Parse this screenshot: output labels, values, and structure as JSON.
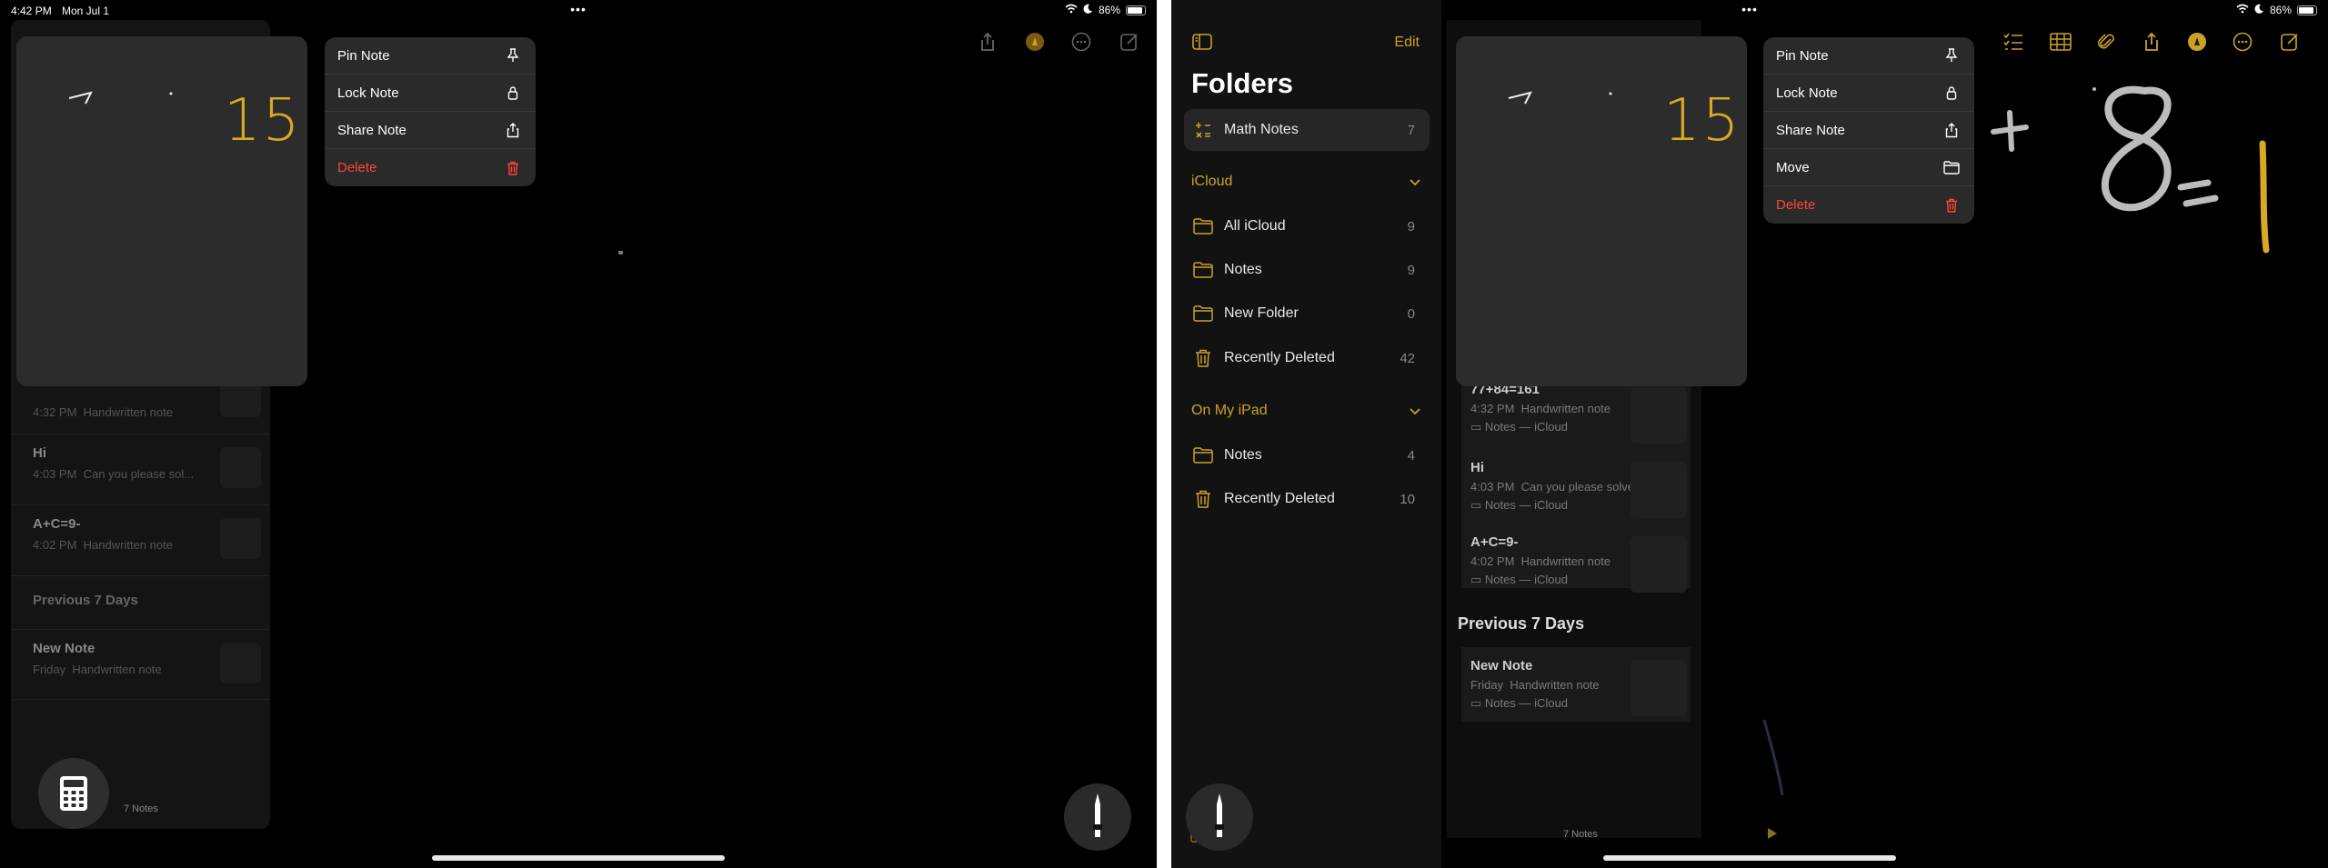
{
  "status": {
    "time": "4:42 PM",
    "date": "Mon Jul 1",
    "battery": "86%"
  },
  "left": {
    "preview_number": "15",
    "menu": [
      {
        "label": "Pin Note",
        "icon": "pin-icon",
        "danger": false
      },
      {
        "label": "Lock Note",
        "icon": "lock-icon",
        "danger": false
      },
      {
        "label": "Share Note",
        "icon": "share-icon",
        "danger": false
      },
      {
        "label": "Delete",
        "icon": "trash-icon",
        "danger": true
      }
    ],
    "notes": [
      {
        "title": "",
        "time": "4:32 PM",
        "preview": "Handwritten note"
      },
      {
        "title": "Hi",
        "time": "4:03 PM",
        "preview": "Can you please sol..."
      },
      {
        "title": "A+C=9-",
        "time": "4:02 PM",
        "preview": "Handwritten note"
      }
    ],
    "section_prev": "Previous 7 Days",
    "prev_note": {
      "title": "New Note",
      "time": "Friday",
      "preview": "Handwritten note"
    },
    "notes_count": "7 Notes"
  },
  "right": {
    "folders_title": "Folders",
    "edit_label": "Edit",
    "math_notes": {
      "name": "Math Notes",
      "count": "7"
    },
    "icloud_label": "iCloud",
    "icloud_folders": [
      {
        "name": "All iCloud",
        "count": "9",
        "icon": "folder-icon"
      },
      {
        "name": "Notes",
        "count": "9",
        "icon": "folder-icon"
      },
      {
        "name": "New Folder",
        "count": "0",
        "icon": "folder-icon"
      },
      {
        "name": "Recently Deleted",
        "count": "42",
        "icon": "trash-icon"
      }
    ],
    "ipad_label": "On My iPad",
    "ipad_folders": [
      {
        "name": "Notes",
        "count": "4",
        "icon": "folder-icon"
      },
      {
        "name": "Recently Deleted",
        "count": "10",
        "icon": "trash-icon"
      }
    ],
    "preview_number": "15",
    "menu": [
      {
        "label": "Pin Note",
        "icon": "pin-icon",
        "danger": false
      },
      {
        "label": "Lock Note",
        "icon": "lock-icon",
        "danger": false
      },
      {
        "label": "Share Note",
        "icon": "share-icon",
        "danger": false
      },
      {
        "label": "Move",
        "icon": "folder-icon",
        "danger": false
      },
      {
        "label": "Delete",
        "icon": "trash-icon",
        "danger": true
      }
    ],
    "notes": [
      {
        "title": "77+84=161",
        "time": "4:32 PM",
        "preview": "Handwritten note",
        "location": "Notes — iCloud"
      },
      {
        "title": "Hi",
        "time": "4:03 PM",
        "preview": "Can you please solve...",
        "location": "Notes — iCloud"
      },
      {
        "title": "A+C=9-",
        "time": "4:02 PM",
        "preview": "Handwritten note",
        "location": "Notes — iCloud"
      }
    ],
    "section_prev": "Previous 7 Days",
    "prev_note": {
      "title": "New Note",
      "time": "Friday",
      "preview": "Handwritten note",
      "location": "Notes — iCloud"
    },
    "notes_count": "7 Notes"
  },
  "colors": {
    "accent": "#c9a227",
    "danger": "#ff453a",
    "menu_bg": "#2a2a2a"
  }
}
